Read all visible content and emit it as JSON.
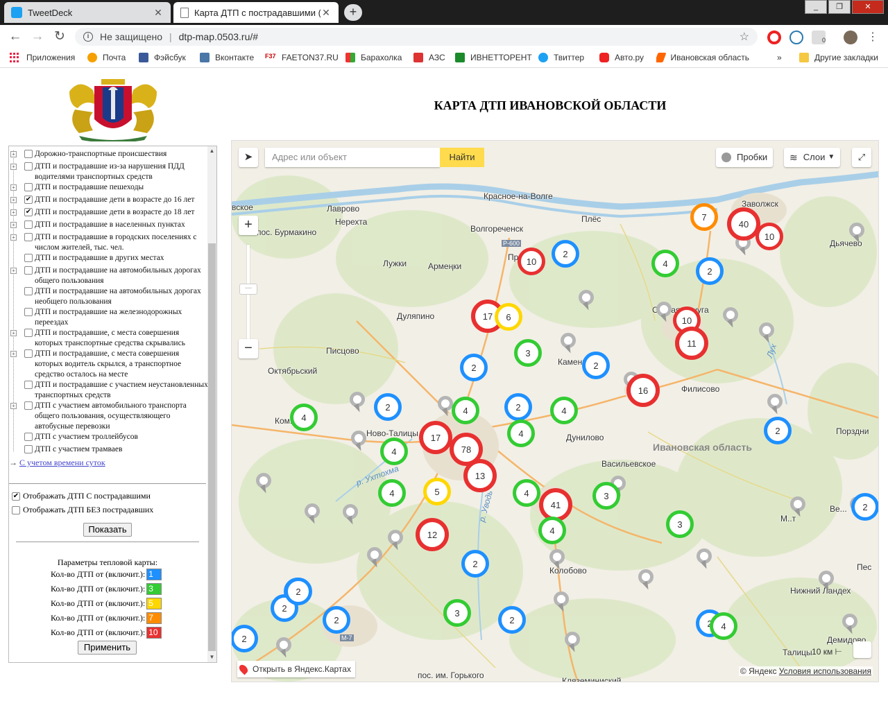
{
  "browser": {
    "tabs": [
      {
        "title": "TweetDeck",
        "active": false
      },
      {
        "title": "Карта ДТП с пострадавшими (тс",
        "active": true
      }
    ],
    "address": {
      "security": "Не защищено",
      "url": "dtp-map.0503.ru/#"
    },
    "bookmarks": [
      "Приложения",
      "Почта",
      "Фэйсбук",
      "Вконтакте",
      "FAETON37.RU",
      "Барахолка",
      "АЗС",
      "ИВНЕТТОРЕНТ",
      "Твиттер",
      "Авто.ру",
      "Ивановская область",
      "»",
      "Другие закладки"
    ],
    "extension_badge": "0"
  },
  "page": {
    "title": "КАРТА ДТП ИВАНОВСКОЙ ОБЛАСТИ"
  },
  "sidebar": {
    "items": [
      {
        "label": "Дорожно-транспортные происшествия",
        "checked": false,
        "expander": true
      },
      {
        "label": "ДТП и пострадавшие из-за нарушения ПДД водителями транспортных средств",
        "checked": false,
        "expander": true
      },
      {
        "label": "ДТП и пострадавшие пешеходы",
        "checked": false,
        "expander": true
      },
      {
        "label": "ДТП и пострадавшие дети в возрасте до 16 лет",
        "checked": true,
        "expander": true
      },
      {
        "label": "ДТП и пострадавшие дети в возрасте до 18 лет",
        "checked": true,
        "expander": true
      },
      {
        "label": "ДТП и пострадавшие в населенных пунктах",
        "checked": false,
        "expander": true
      },
      {
        "label": "ДТП и пострадавшие в городских поселениях с числом жителей, тыс. чел.",
        "checked": false,
        "expander": true
      },
      {
        "label": "ДТП и пострадавшие в других местах",
        "checked": false,
        "expander": false
      },
      {
        "label": "ДТП и пострадавшие на автомобильных дорогах общего пользования",
        "checked": false,
        "expander": true
      },
      {
        "label": "ДТП и пострадавшие на автомобильных дорогах необщего пользования",
        "checked": false,
        "expander": false
      },
      {
        "label": "ДТП и пострадавшие на железнодорожных переездах",
        "checked": false,
        "expander": false
      },
      {
        "label": "ДТП и пострадавшие, с места совершения которых транспортные средства скрывались",
        "checked": false,
        "expander": true
      },
      {
        "label": "ДТП и пострадавшие, с места совершения которых водитель скрылся, а транспортное средство осталось на месте",
        "checked": false,
        "expander": true
      },
      {
        "label": "ДТП и пострадавшие с участием неустановленных транспортных средств",
        "checked": false,
        "expander": false
      },
      {
        "label": "ДТП с участием автомобильного транспорта общего пользования, осуществляющего автобусные перевозки",
        "checked": false,
        "expander": true
      },
      {
        "label": "ДТП с участием троллейбусов",
        "checked": false,
        "expander": false
      },
      {
        "label": "ДТП с участием трамваев",
        "checked": false,
        "expander": false
      }
    ],
    "time_link_arrow": "→",
    "time_link": "С учетом времени суток",
    "show_with_injured": "Отображать ДТП С пострадавшими",
    "show_with_injured_checked": true,
    "show_without_injured": "Отображать ДТП БЕЗ пострадавших",
    "show_without_injured_checked": false,
    "show_button": "Показать",
    "heatmap_title": "Параметры тепловой карты:",
    "heatmap_rows": [
      {
        "label": "Кол-во ДТП от (включит.):",
        "value": "1",
        "color": "#1e90ff"
      },
      {
        "label": "Кол-во ДТП от (включит.):",
        "value": "3",
        "color": "#33cc33"
      },
      {
        "label": "Кол-во ДТП от (включит.):",
        "value": "5",
        "color": "#ffd700"
      },
      {
        "label": "Кол-во ДТП от (включит.):",
        "value": "7",
        "color": "#ff8c00"
      },
      {
        "label": "Кол-во ДТП от (включит.):",
        "value": "10",
        "color": "#e83030"
      }
    ],
    "apply_button": "Применить"
  },
  "map": {
    "search_placeholder": "Адрес или объект",
    "search_button": "Найти",
    "traffic": "Пробки",
    "layers": "Слои",
    "open_in_yandex": "Открыть в Яндекс.Картах",
    "copyright": "© Яндекс",
    "terms": "Условия использования",
    "scale": "10 км",
    "region_label": "Ивановская область",
    "places": [
      "Красное-на-Волге",
      "Заволжск",
      "Лаврово",
      "Нерехта",
      "Волгореченск",
      "Плёс",
      "Дьячево",
      "пос. Бурмакино",
      "Армеңки",
      "Лужки",
      "Дуляпино",
      "Писцово",
      "Октябрьский",
      "Филисово",
      "Дунилово",
      "Васильевское",
      "Порздни",
      "Ново-Талицы",
      "Колобово",
      "Нижний Ландех",
      "Демидово",
      "Талицы",
      "пос. им. Горького",
      "Кляземиниский",
      "Каменка",
      "Старая Вичуга",
      "Ком...ьск",
      "вское",
      "Ве...",
      "Пес",
      "М..т",
      "Пр..."
    ],
    "river_labels": [
      "р. Ухтохма",
      "р. Уводь",
      "Лух"
    ],
    "road_labels": [
      "Р-600",
      "М-7"
    ],
    "clusters": [
      {
        "count": "7",
        "color": "#ff8c00"
      },
      {
        "count": "40",
        "color": "#e83030"
      },
      {
        "count": "10",
        "color": "#e83030"
      },
      {
        "count": "10",
        "color": "#e83030"
      },
      {
        "count": "2",
        "color": "#1e90ff"
      },
      {
        "count": "4",
        "color": "#33cc33"
      },
      {
        "count": "2",
        "color": "#1e90ff"
      },
      {
        "count": "17",
        "color": "#e83030"
      },
      {
        "count": "6",
        "color": "#ffd700"
      },
      {
        "count": "10",
        "color": "#e83030"
      },
      {
        "count": "11",
        "color": "#e83030"
      },
      {
        "count": "3",
        "color": "#33cc33"
      },
      {
        "count": "2",
        "color": "#1e90ff"
      },
      {
        "count": "2",
        "color": "#1e90ff"
      },
      {
        "count": "16",
        "color": "#e83030"
      },
      {
        "count": "4",
        "color": "#33cc33"
      },
      {
        "count": "2",
        "color": "#1e90ff"
      },
      {
        "count": "4",
        "color": "#33cc33"
      },
      {
        "count": "2",
        "color": "#1e90ff"
      },
      {
        "count": "4",
        "color": "#33cc33"
      },
      {
        "count": "2",
        "color": "#1e90ff"
      },
      {
        "count": "17",
        "color": "#e83030"
      },
      {
        "count": "78",
        "color": "#e83030"
      },
      {
        "count": "4",
        "color": "#33cc33"
      },
      {
        "count": "4",
        "color": "#33cc33"
      },
      {
        "count": "13",
        "color": "#e83030"
      },
      {
        "count": "4",
        "color": "#33cc33"
      },
      {
        "count": "5",
        "color": "#ffd700"
      },
      {
        "count": "4",
        "color": "#33cc33"
      },
      {
        "count": "41",
        "color": "#e83030"
      },
      {
        "count": "3",
        "color": "#33cc33"
      },
      {
        "count": "2",
        "color": "#1e90ff"
      },
      {
        "count": "12",
        "color": "#e83030"
      },
      {
        "count": "4",
        "color": "#33cc33"
      },
      {
        "count": "3",
        "color": "#33cc33"
      },
      {
        "count": "2",
        "color": "#1e90ff"
      },
      {
        "count": "2",
        "color": "#1e90ff"
      },
      {
        "count": "2",
        "color": "#1e90ff"
      },
      {
        "count": "2",
        "color": "#1e90ff"
      },
      {
        "count": "3",
        "color": "#33cc33"
      },
      {
        "count": "2",
        "color": "#1e90ff"
      },
      {
        "count": "2",
        "color": "#1e90ff"
      },
      {
        "count": "4",
        "color": "#33cc33"
      },
      {
        "count": "2",
        "color": "#1e90ff"
      },
      {
        "count": "2",
        "color": "#1e90ff"
      }
    ]
  }
}
